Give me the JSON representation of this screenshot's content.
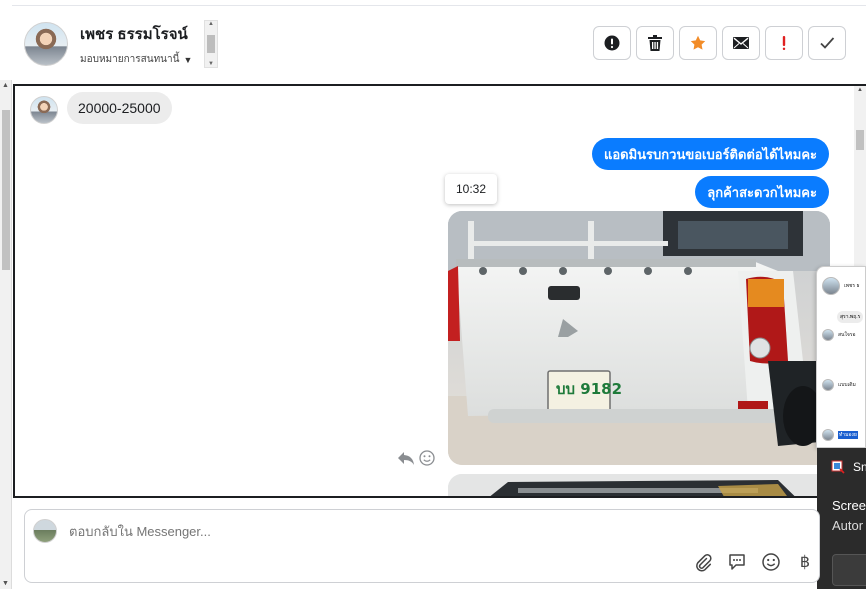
{
  "header": {
    "contact_name": "เพชร ธรรมโรจน์",
    "assign_label": "มอบหมายการสนทนานี้"
  },
  "actions": [
    {
      "name": "info",
      "icon": "exclamation-circle-icon"
    },
    {
      "name": "delete",
      "icon": "trash-icon"
    },
    {
      "name": "star",
      "icon": "star-icon",
      "color": "#f28c28"
    },
    {
      "name": "mark-unread",
      "icon": "envelope-icon"
    },
    {
      "name": "spam",
      "icon": "exclamation-icon",
      "color": "#e02020"
    },
    {
      "name": "done",
      "icon": "checkmark-icon"
    }
  ],
  "messages": {
    "incoming_1": "20000-25000",
    "outgoing_1": "แอดมินรบกวนขอเบอร์ติดต่อได้ไหมคะ",
    "outgoing_2": "ลุกค้าสะดวกไหมคะ",
    "timestamp": "10:32",
    "photo_plate": "บบ 9182"
  },
  "side_popup": {
    "chip": "สุรา.พฤ.ร",
    "rows": [
      "เพชร ธ",
      "สนใจรอ",
      "แบบเดิม",
      "ทำมองย"
    ]
  },
  "toast": {
    "app_name": "Sn",
    "line1": "Scree",
    "line2": "Autor"
  },
  "composer": {
    "placeholder": "ตอบกลับใน Messenger...",
    "currency_symbol": "฿"
  },
  "colors": {
    "accent_blue": "#0a7cff",
    "star_orange": "#f28c28",
    "spam_red": "#e02020"
  }
}
